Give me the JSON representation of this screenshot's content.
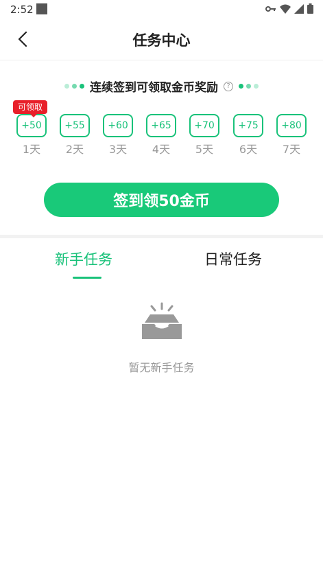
{
  "status_bar": {
    "time": "2:52",
    "icons": [
      "key-icon",
      "wifi-icon",
      "signal-icon",
      "battery-icon"
    ]
  },
  "nav": {
    "title": "任务中心",
    "back_icon": "chevron-left-icon"
  },
  "signin": {
    "title": "连续签到可领取金币奖励",
    "help_icon": "question-circle-icon",
    "claim_badge": "可领取",
    "days": [
      {
        "reward": "+50",
        "label": "1天"
      },
      {
        "reward": "+55",
        "label": "2天"
      },
      {
        "reward": "+60",
        "label": "3天"
      },
      {
        "reward": "+65",
        "label": "4天"
      },
      {
        "reward": "+70",
        "label": "5天"
      },
      {
        "reward": "+75",
        "label": "6天"
      },
      {
        "reward": "+80",
        "label": "7天"
      }
    ],
    "button_label": "签到领50金币"
  },
  "tabs": [
    {
      "label": "新手任务",
      "active": true
    },
    {
      "label": "日常任务",
      "active": false
    }
  ],
  "empty": {
    "icon": "empty-box-icon",
    "text": "暂无新手任务"
  },
  "colors": {
    "accent": "#19c27a",
    "badge": "#e8202a",
    "text_secondary": "#999999"
  }
}
